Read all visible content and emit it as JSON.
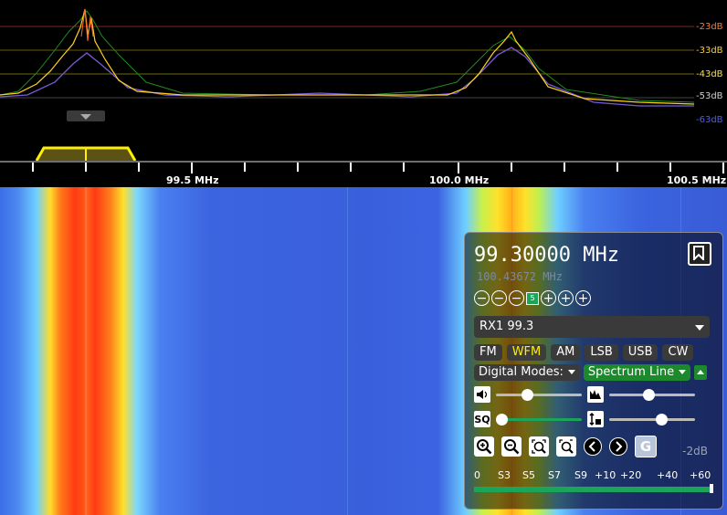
{
  "spectrum": {
    "db_labels": [
      "-23dB",
      "-33dB",
      "-43dB",
      "-53dB",
      "-63dB"
    ],
    "db_colors": [
      "#ff7a2a",
      "#ffd21a",
      "#ffe02a",
      "#cfcfcf",
      "#4a5cff"
    ],
    "freq_labels": [
      "99.5 MHz",
      "100.0 MHz",
      "100.5 MHz"
    ]
  },
  "panel": {
    "frequency": "99.30000 MHz",
    "offset_frequency": "100.43672 MHz",
    "step_badge": "5",
    "receiver_select": "RX1 99.3",
    "modes": [
      {
        "label": "FM",
        "active": false
      },
      {
        "label": "WFM",
        "active": true
      },
      {
        "label": "AM",
        "active": false
      },
      {
        "label": "LSB",
        "active": false
      },
      {
        "label": "USB",
        "active": false
      },
      {
        "label": "CW",
        "active": false
      }
    ],
    "digital_modes_label": "Digital Modes:",
    "display_mode_label": "Spectrum Line",
    "sliders": {
      "volume": 0.28,
      "nr": 0.45,
      "squelch": 0.0,
      "gain": 0.6
    },
    "squelch_icon": "SQ",
    "squelch_level_db": "-2dB",
    "g_button": "G",
    "smeter_labels": [
      "0",
      "S3",
      "S5",
      "S7",
      "S9",
      "+10",
      "+20",
      "+40",
      "+60"
    ]
  },
  "icons": {
    "bookmark": "bookmark-icon",
    "zoom_in": "zoom-in-icon",
    "zoom_out": "zoom-out-icon",
    "zoom_fit": "zoom-fit-icon",
    "zoom_reset": "zoom-reset-icon",
    "prev": "chevron-left-icon",
    "next": "chevron-right-icon",
    "volume": "speaker-icon",
    "nr": "noise-reduction-icon",
    "gain": "gain-icon"
  }
}
